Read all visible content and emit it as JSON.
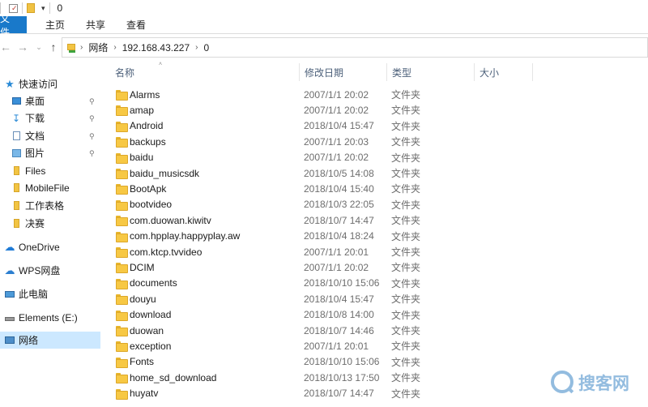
{
  "window": {
    "title": "0"
  },
  "ribbon": {
    "tabs": [
      "文件",
      "主页",
      "共享",
      "查看"
    ]
  },
  "address": {
    "crumbs": [
      "网络",
      "192.168.43.227",
      "0"
    ]
  },
  "nav_pane": {
    "quick_access": "快速访问",
    "items": [
      {
        "label": "桌面",
        "icon": "desktop-icon",
        "pinned": true
      },
      {
        "label": "下载",
        "icon": "download-icon",
        "pinned": true
      },
      {
        "label": "文档",
        "icon": "document-icon",
        "pinned": true
      },
      {
        "label": "图片",
        "icon": "picture-icon",
        "pinned": true
      },
      {
        "label": "Files",
        "icon": "folder-icon",
        "pinned": false
      },
      {
        "label": "MobileFile",
        "icon": "folder-icon",
        "pinned": false
      },
      {
        "label": "工作表格",
        "icon": "folder-icon",
        "pinned": false
      },
      {
        "label": "决赛",
        "icon": "folder-icon",
        "pinned": false
      }
    ],
    "onedrive": "OneDrive",
    "wps": "WPS网盘",
    "this_pc": "此电脑",
    "elements": "Elements (E:)",
    "network": "网络"
  },
  "columns": {
    "name": "名称",
    "date": "修改日期",
    "type": "类型",
    "size": "大小"
  },
  "files": [
    {
      "name": "Alarms",
      "date": "2007/1/1 20:02",
      "type": "文件夹"
    },
    {
      "name": "amap",
      "date": "2007/1/1 20:02",
      "type": "文件夹"
    },
    {
      "name": "Android",
      "date": "2018/10/4 15:47",
      "type": "文件夹"
    },
    {
      "name": "backups",
      "date": "2007/1/1 20:03",
      "type": "文件夹"
    },
    {
      "name": "baidu",
      "date": "2007/1/1 20:02",
      "type": "文件夹"
    },
    {
      "name": "baidu_musicsdk",
      "date": "2018/10/5 14:08",
      "type": "文件夹"
    },
    {
      "name": "BootApk",
      "date": "2018/10/4 15:40",
      "type": "文件夹"
    },
    {
      "name": "bootvideo",
      "date": "2018/10/3 22:05",
      "type": "文件夹"
    },
    {
      "name": "com.duowan.kiwitv",
      "date": "2018/10/7 14:47",
      "type": "文件夹"
    },
    {
      "name": "com.hpplay.happyplay.aw",
      "date": "2018/10/4 18:24",
      "type": "文件夹"
    },
    {
      "name": "com.ktcp.tvvideo",
      "date": "2007/1/1 20:01",
      "type": "文件夹"
    },
    {
      "name": "DCIM",
      "date": "2007/1/1 20:02",
      "type": "文件夹"
    },
    {
      "name": "documents",
      "date": "2018/10/10 15:06",
      "type": "文件夹"
    },
    {
      "name": "douyu",
      "date": "2018/10/4 15:47",
      "type": "文件夹"
    },
    {
      "name": "download",
      "date": "2018/10/8 14:00",
      "type": "文件夹"
    },
    {
      "name": "duowan",
      "date": "2018/10/7 14:46",
      "type": "文件夹"
    },
    {
      "name": "exception",
      "date": "2007/1/1 20:01",
      "type": "文件夹"
    },
    {
      "name": "Fonts",
      "date": "2018/10/10 15:06",
      "type": "文件夹"
    },
    {
      "name": "home_sd_download",
      "date": "2018/10/13 17:50",
      "type": "文件夹"
    },
    {
      "name": "huyatv",
      "date": "2018/10/7 14:47",
      "type": "文件夹"
    }
  ],
  "watermark": {
    "text": "搜客网"
  },
  "colors": {
    "accent": "#1979ca",
    "selected": "#cce8ff",
    "folder": "#f7c844"
  }
}
